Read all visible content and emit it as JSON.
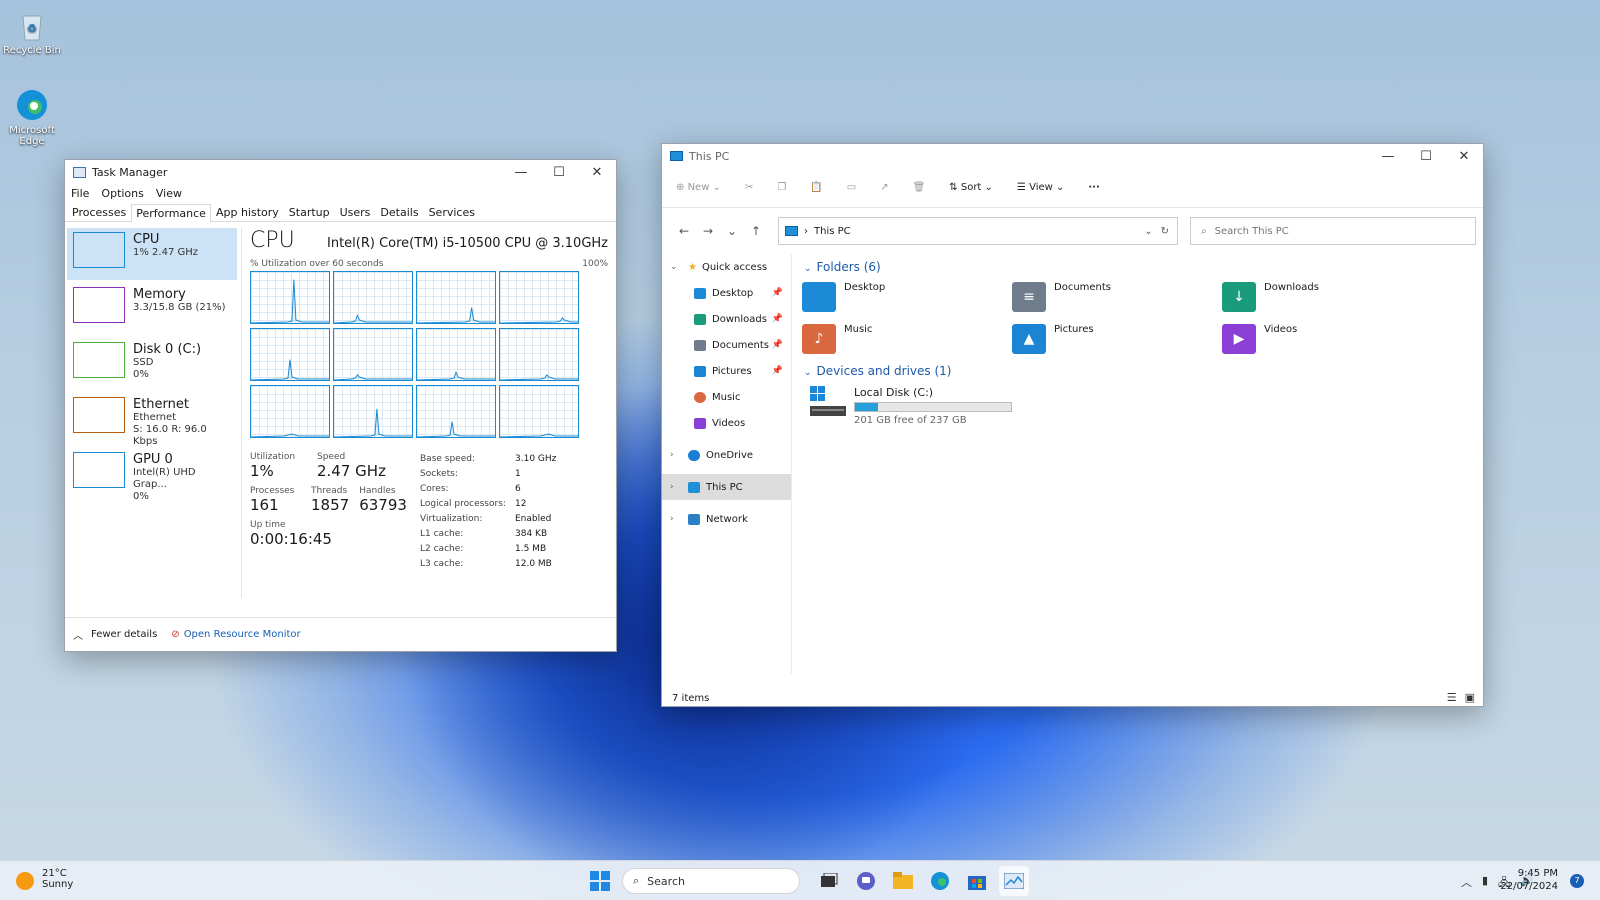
{
  "desktop": {
    "recycle_bin": "Recycle Bin",
    "edge": "Microsoft Edge"
  },
  "task_manager": {
    "title": "Task Manager",
    "menu": [
      "File",
      "Options",
      "View"
    ],
    "tabs": [
      "Processes",
      "Performance",
      "App history",
      "Startup",
      "Users",
      "Details",
      "Services"
    ],
    "active_tab": "Performance",
    "resources": [
      {
        "name": "CPU",
        "l2": "1% 2.47 GHz",
        "l3": "",
        "color": "#1a8ad4"
      },
      {
        "name": "Memory",
        "l2": "3.3/15.8 GB (21%)",
        "l3": "",
        "color": "#8e2fb8"
      },
      {
        "name": "Disk 0 (C:)",
        "l2": "SSD",
        "l3": "0%",
        "color": "#4fae3a"
      },
      {
        "name": "Ethernet",
        "l2": "Ethernet",
        "l3": "S: 16.0  R: 96.0 Kbps",
        "color": "#b85e12"
      },
      {
        "name": "GPU 0",
        "l2": "Intel(R) UHD Grap...",
        "l3": "0%",
        "color": "#1a8ad4"
      }
    ],
    "cpu": {
      "title": "CPU",
      "model": "Intel(R) Core(TM) i5-10500 CPU @ 3.10GHz",
      "util_label": "% Utilization over 60 seconds",
      "util_max": "100%",
      "utilization_label": "Utilization",
      "utilization": "1%",
      "speed_label": "Speed",
      "speed": "2.47 GHz",
      "processes_label": "Processes",
      "processes": "161",
      "threads_label": "Threads",
      "threads": "1857",
      "handles_label": "Handles",
      "handles": "63793",
      "uptime_label": "Up time",
      "uptime": "0:00:16:45",
      "details": [
        [
          "Base speed:",
          "3.10 GHz"
        ],
        [
          "Sockets:",
          "1"
        ],
        [
          "Cores:",
          "6"
        ],
        [
          "Logical processors:",
          "12"
        ],
        [
          "Virtualization:",
          "Enabled"
        ],
        [
          "L1 cache:",
          "384 KB"
        ],
        [
          "L2 cache:",
          "1.5 MB"
        ],
        [
          "L3 cache:",
          "12.0 MB"
        ]
      ]
    },
    "footer": {
      "fewer": "Fewer details",
      "monitor": "Open Resource Monitor"
    }
  },
  "explorer": {
    "title": "This PC",
    "toolbar": {
      "new": "New",
      "sort": "Sort",
      "view": "View",
      "more": "···"
    },
    "address": "This PC",
    "search_placeholder": "Search This PC",
    "sidebar": {
      "quick_access": "Quick access",
      "desktop": "Desktop",
      "downloads": "Downloads",
      "documents": "Documents",
      "pictures": "Pictures",
      "music": "Music",
      "videos": "Videos",
      "onedrive": "OneDrive",
      "this_pc": "This PC",
      "network": "Network"
    },
    "folders_header": "Folders (6)",
    "folders": [
      {
        "name": "Desktop",
        "color": "#1d8ad8",
        "glyph": ""
      },
      {
        "name": "Documents",
        "color": "#6f7c8c",
        "glyph": "≡"
      },
      {
        "name": "Downloads",
        "color": "#1a9b7c",
        "glyph": "↓"
      },
      {
        "name": "Music",
        "color": "#d9683f",
        "glyph": "♪"
      },
      {
        "name": "Pictures",
        "color": "#1c84d4",
        "glyph": "▲"
      },
      {
        "name": "Videos",
        "color": "#8c3fd6",
        "glyph": "▶"
      }
    ],
    "drives_header": "Devices and drives (1)",
    "drive": {
      "name": "Local Disk (C:)",
      "free": "201 GB free of 237 GB",
      "used_fraction": 0.15
    },
    "status": "7 items"
  },
  "taskbar": {
    "temp": "21°C",
    "condition": "Sunny",
    "search": "Search",
    "time": "9:45 PM",
    "date": "22/07/2024",
    "notifications": "7"
  }
}
